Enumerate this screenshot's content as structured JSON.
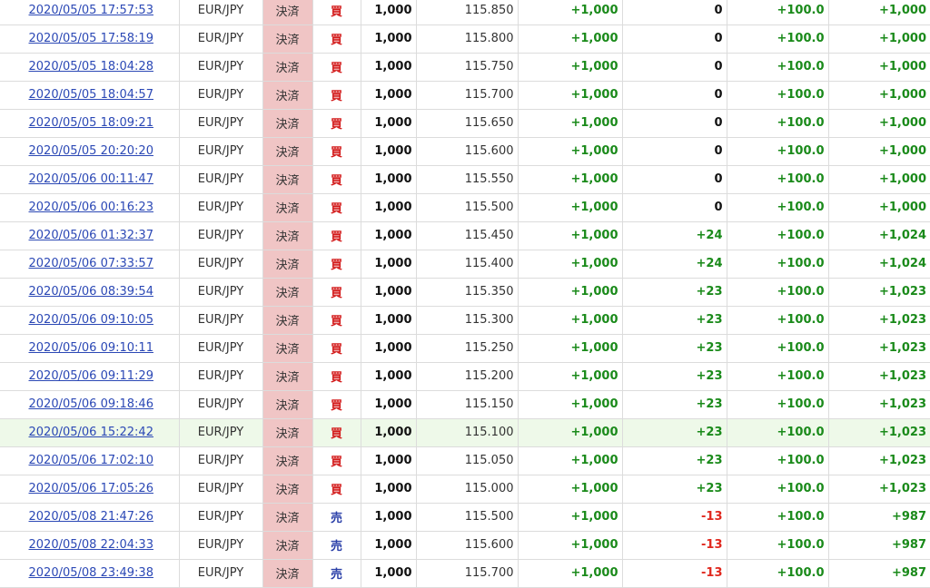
{
  "colors": {
    "link": "#2b48b5",
    "buy": "#d31b1b",
    "sell": "#2a3fa8",
    "positive": "#1a8a1a",
    "negative": "#e0281e",
    "type_bg": "#f0c5c5",
    "highlight_bg": "#eef9e9"
  },
  "rows": [
    {
      "datetime": "2020/05/05 17:57:53",
      "pair": "EUR/JPY",
      "type": "決済",
      "side": "買",
      "qty": "1,000",
      "rate": "115.850",
      "pl": "+1,000",
      "swap": "0",
      "pips": "+100.0",
      "total": "+1,000"
    },
    {
      "datetime": "2020/05/05 17:58:19",
      "pair": "EUR/JPY",
      "type": "決済",
      "side": "買",
      "qty": "1,000",
      "rate": "115.800",
      "pl": "+1,000",
      "swap": "0",
      "pips": "+100.0",
      "total": "+1,000"
    },
    {
      "datetime": "2020/05/05 18:04:28",
      "pair": "EUR/JPY",
      "type": "決済",
      "side": "買",
      "qty": "1,000",
      "rate": "115.750",
      "pl": "+1,000",
      "swap": "0",
      "pips": "+100.0",
      "total": "+1,000"
    },
    {
      "datetime": "2020/05/05 18:04:57",
      "pair": "EUR/JPY",
      "type": "決済",
      "side": "買",
      "qty": "1,000",
      "rate": "115.700",
      "pl": "+1,000",
      "swap": "0",
      "pips": "+100.0",
      "total": "+1,000"
    },
    {
      "datetime": "2020/05/05 18:09:21",
      "pair": "EUR/JPY",
      "type": "決済",
      "side": "買",
      "qty": "1,000",
      "rate": "115.650",
      "pl": "+1,000",
      "swap": "0",
      "pips": "+100.0",
      "total": "+1,000"
    },
    {
      "datetime": "2020/05/05 20:20:20",
      "pair": "EUR/JPY",
      "type": "決済",
      "side": "買",
      "qty": "1,000",
      "rate": "115.600",
      "pl": "+1,000",
      "swap": "0",
      "pips": "+100.0",
      "total": "+1,000"
    },
    {
      "datetime": "2020/05/06 00:11:47",
      "pair": "EUR/JPY",
      "type": "決済",
      "side": "買",
      "qty": "1,000",
      "rate": "115.550",
      "pl": "+1,000",
      "swap": "0",
      "pips": "+100.0",
      "total": "+1,000"
    },
    {
      "datetime": "2020/05/06 00:16:23",
      "pair": "EUR/JPY",
      "type": "決済",
      "side": "買",
      "qty": "1,000",
      "rate": "115.500",
      "pl": "+1,000",
      "swap": "0",
      "pips": "+100.0",
      "total": "+1,000"
    },
    {
      "datetime": "2020/05/06 01:32:37",
      "pair": "EUR/JPY",
      "type": "決済",
      "side": "買",
      "qty": "1,000",
      "rate": "115.450",
      "pl": "+1,000",
      "swap": "+24",
      "pips": "+100.0",
      "total": "+1,024"
    },
    {
      "datetime": "2020/05/06 07:33:57",
      "pair": "EUR/JPY",
      "type": "決済",
      "side": "買",
      "qty": "1,000",
      "rate": "115.400",
      "pl": "+1,000",
      "swap": "+24",
      "pips": "+100.0",
      "total": "+1,024"
    },
    {
      "datetime": "2020/05/06 08:39:54",
      "pair": "EUR/JPY",
      "type": "決済",
      "side": "買",
      "qty": "1,000",
      "rate": "115.350",
      "pl": "+1,000",
      "swap": "+23",
      "pips": "+100.0",
      "total": "+1,023"
    },
    {
      "datetime": "2020/05/06 09:10:05",
      "pair": "EUR/JPY",
      "type": "決済",
      "side": "買",
      "qty": "1,000",
      "rate": "115.300",
      "pl": "+1,000",
      "swap": "+23",
      "pips": "+100.0",
      "total": "+1,023"
    },
    {
      "datetime": "2020/05/06 09:10:11",
      "pair": "EUR/JPY",
      "type": "決済",
      "side": "買",
      "qty": "1,000",
      "rate": "115.250",
      "pl": "+1,000",
      "swap": "+23",
      "pips": "+100.0",
      "total": "+1,023"
    },
    {
      "datetime": "2020/05/06 09:11:29",
      "pair": "EUR/JPY",
      "type": "決済",
      "side": "買",
      "qty": "1,000",
      "rate": "115.200",
      "pl": "+1,000",
      "swap": "+23",
      "pips": "+100.0",
      "total": "+1,023"
    },
    {
      "datetime": "2020/05/06 09:18:46",
      "pair": "EUR/JPY",
      "type": "決済",
      "side": "買",
      "qty": "1,000",
      "rate": "115.150",
      "pl": "+1,000",
      "swap": "+23",
      "pips": "+100.0",
      "total": "+1,023"
    },
    {
      "datetime": "2020/05/06 15:22:42",
      "pair": "EUR/JPY",
      "type": "決済",
      "side": "買",
      "qty": "1,000",
      "rate": "115.100",
      "pl": "+1,000",
      "swap": "+23",
      "pips": "+100.0",
      "total": "+1,023",
      "highlight": true
    },
    {
      "datetime": "2020/05/06 17:02:10",
      "pair": "EUR/JPY",
      "type": "決済",
      "side": "買",
      "qty": "1,000",
      "rate": "115.050",
      "pl": "+1,000",
      "swap": "+23",
      "pips": "+100.0",
      "total": "+1,023"
    },
    {
      "datetime": "2020/05/06 17:05:26",
      "pair": "EUR/JPY",
      "type": "決済",
      "side": "買",
      "qty": "1,000",
      "rate": "115.000",
      "pl": "+1,000",
      "swap": "+23",
      "pips": "+100.0",
      "total": "+1,023"
    },
    {
      "datetime": "2020/05/08 21:47:26",
      "pair": "EUR/JPY",
      "type": "決済",
      "side": "売",
      "qty": "1,000",
      "rate": "115.500",
      "pl": "+1,000",
      "swap": "-13",
      "pips": "+100.0",
      "total": "+987"
    },
    {
      "datetime": "2020/05/08 22:04:33",
      "pair": "EUR/JPY",
      "type": "決済",
      "side": "売",
      "qty": "1,000",
      "rate": "115.600",
      "pl": "+1,000",
      "swap": "-13",
      "pips": "+100.0",
      "total": "+987"
    },
    {
      "datetime": "2020/05/08 23:49:38",
      "pair": "EUR/JPY",
      "type": "決済",
      "side": "売",
      "qty": "1,000",
      "rate": "115.700",
      "pl": "+1,000",
      "swap": "-13",
      "pips": "+100.0",
      "total": "+987"
    }
  ]
}
